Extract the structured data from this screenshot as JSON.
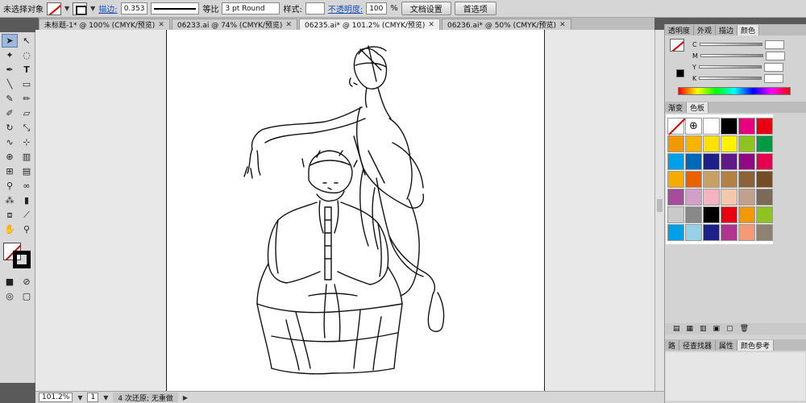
{
  "control": {
    "selection_label": "未选择对象",
    "stroke_label": "描边:",
    "stroke_value": "0.353",
    "scale_label": "等比",
    "brush_label": "3 pt Round",
    "style_label": "样式:",
    "opacity_label": "不透明度:",
    "opacity_value": "100",
    "opacity_unit": "%",
    "doc_setup": "文档设置",
    "preferences": "首选项"
  },
  "tabs": [
    {
      "label": "未标题-1* @ 100% (CMYK/预览)"
    },
    {
      "label": "06233.ai @ 74% (CMYK/预览)"
    },
    {
      "label": "06235.ai* @ 101.2% (CMYK/预览)"
    },
    {
      "label": "06236.ai* @ 50% (CMYK/预览)"
    }
  ],
  "status": {
    "zoom": "101.2%",
    "page": "1",
    "hint": "4 次还原; 无重做"
  },
  "panels": {
    "top_tabs": [
      "透明度",
      "外观",
      "描边",
      "颜色"
    ],
    "color_channels": [
      "C",
      "M",
      "Y",
      "K"
    ],
    "swatch_tabs": [
      "渐变",
      "色板"
    ],
    "bottom_tabs": [
      "路",
      "径查找器",
      "属性",
      "颜色参考"
    ]
  },
  "swatches": [
    "none",
    "reg",
    "#ffffff",
    "#000000",
    "#e6007e",
    "#e60012",
    "#f39800",
    "#f8b500",
    "#ffe100",
    "#fff100",
    "#8fc31f",
    "#009944",
    "#00a0e9",
    "#0068b7",
    "#1d2088",
    "#601986",
    "#920783",
    "#e5004f",
    "#f6ab00",
    "#eb6100",
    "#c8a063",
    "#b28146",
    "#8c6239",
    "#754c24",
    "#a84b9c",
    "#d19fc8",
    "#f5b2c0",
    "#f2c9ac",
    "#c1a18c",
    "#7b6a58",
    "#c9c9c9",
    "#898989",
    "#000000",
    "#e60012",
    "#f39800",
    "#8fc31f",
    "#00a0e9",
    "#96d1e7",
    "#1d2088",
    "#b0358e",
    "#f29b76",
    "#8f8270"
  ],
  "colors": {
    "accent": "#1a4fb5",
    "panel_bg": "#d3d3d3",
    "canvas_bg": "#e8e8e8"
  }
}
